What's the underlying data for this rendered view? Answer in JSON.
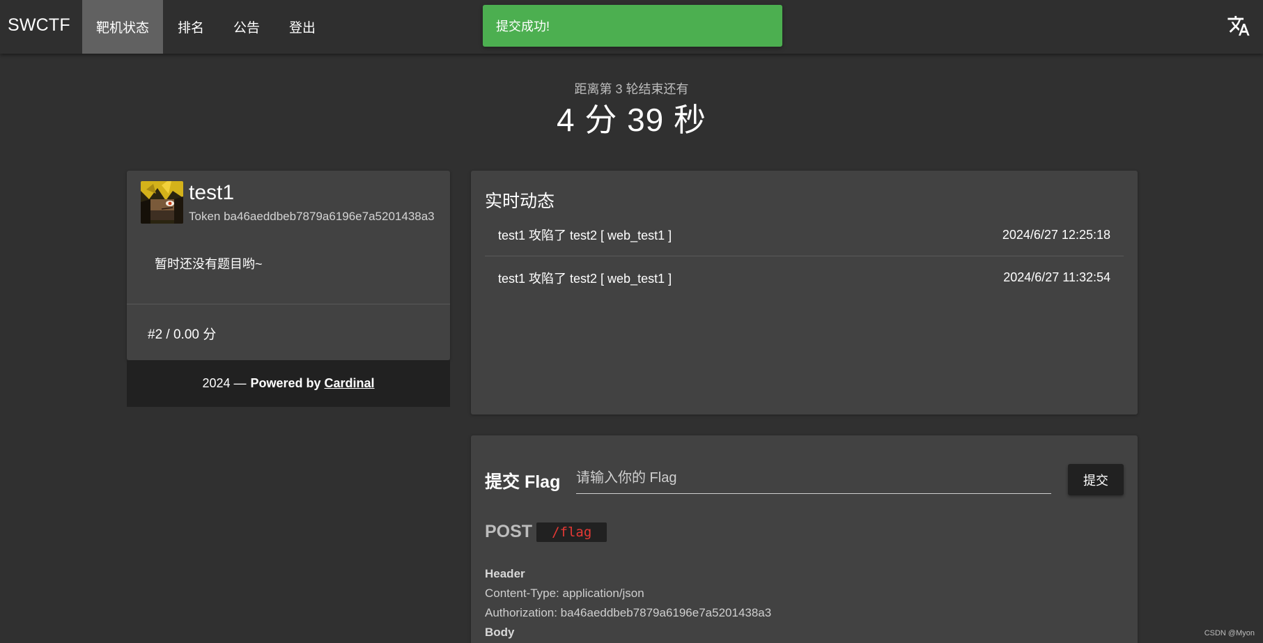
{
  "brand": "SWCTF",
  "nav": {
    "items": [
      "靶机状态",
      "排名",
      "公告",
      "登出"
    ],
    "active_index": 0
  },
  "toast": {
    "message": "提交成功!",
    "color": "#4caf50"
  },
  "countdown": {
    "label": "距离第 3 轮结束还有",
    "time": "4 分 39 秒"
  },
  "profile": {
    "username": "test1",
    "token": "Token ba46aeddbeb7879a6196e7a5201438a3",
    "no_challenge": "暂时还没有题目哟~",
    "rank_score": "#2 / 0.00 分"
  },
  "footer": {
    "year": "2024 —",
    "powered": "Powered by",
    "link": "Cardinal"
  },
  "feed": {
    "title": "实时动态",
    "items": [
      {
        "text": "test1 攻陷了 test2 [ web_test1 ]",
        "time": "2024/6/27 12:25:18"
      },
      {
        "text": "test1 攻陷了 test2 [ web_test1 ]",
        "time": "2024/6/27 11:32:54"
      }
    ]
  },
  "flag": {
    "title": "提交 Flag",
    "placeholder": "请输入你的 Flag",
    "submit_label": "提交",
    "method": "POST",
    "path": "/flag",
    "header_label": "Header",
    "content_type": "Content-Type: application/json",
    "authorization": "Authorization: ba46aeddbeb7879a6196e7a5201438a3",
    "body_label": "Body"
  },
  "watermark": "CSDN @Myon⁠",
  "icons": {
    "translate": "translate-icon"
  }
}
